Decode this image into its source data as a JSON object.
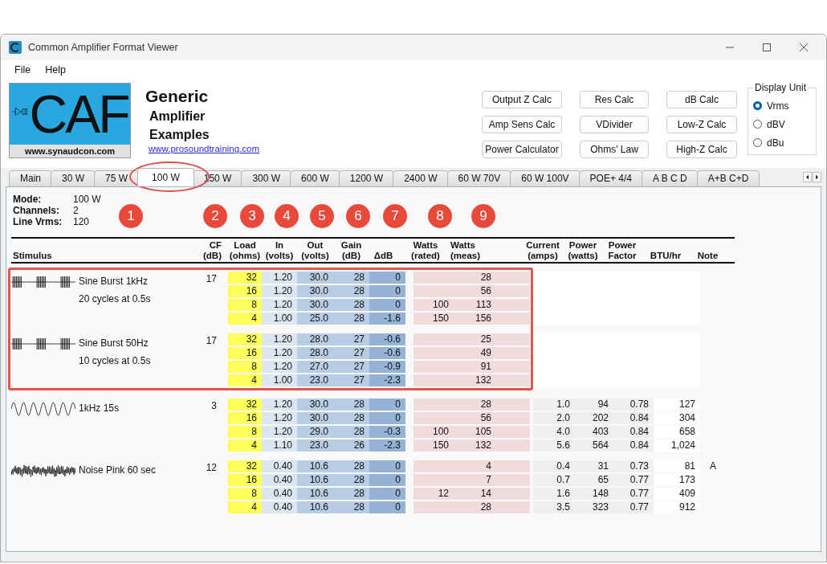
{
  "window": {
    "title": "Common Amplifier Format Viewer"
  },
  "menu": [
    "File",
    "Help"
  ],
  "logo": {
    "text": "CAF",
    "caption": "www.synaudcon.com"
  },
  "heading": {
    "title": "Generic",
    "subtitle_lines": [
      "Amplifier",
      "Examples"
    ],
    "link": "www.prosoundtraining.com"
  },
  "buttons": [
    "Output Z Calc",
    "Res Calc",
    "dB Calc",
    "Amp Sens Calc",
    "VDivider",
    "Low-Z Calc",
    "Power Calculator",
    "Ohms' Law",
    "High-Z Calc"
  ],
  "display_unit": {
    "title": "Display Unit",
    "options": [
      {
        "label": "Vrms",
        "selected": true
      },
      {
        "label": "dBV",
        "selected": false
      },
      {
        "label": "dBu",
        "selected": false
      }
    ]
  },
  "tabs": [
    {
      "label": "Main",
      "selected": false,
      "circled": false
    },
    {
      "label": "30 W",
      "selected": false,
      "circled": false
    },
    {
      "label": "75 W",
      "selected": false,
      "circled": false
    },
    {
      "label": "100 W",
      "selected": true,
      "circled": true
    },
    {
      "label": "150 W",
      "selected": false,
      "circled": false
    },
    {
      "label": "300 W",
      "selected": false,
      "circled": false
    },
    {
      "label": "600 W",
      "selected": false,
      "circled": false
    },
    {
      "label": "1200 W",
      "selected": false,
      "circled": false
    },
    {
      "label": "2400 W",
      "selected": false,
      "circled": false
    },
    {
      "label": "60 W 70V",
      "selected": false,
      "circled": false
    },
    {
      "label": "60 W 100V",
      "selected": false,
      "circled": false
    },
    {
      "label": "POE+ 4/4",
      "selected": false,
      "circled": false
    },
    {
      "label": "A B C D",
      "selected": false,
      "circled": false
    },
    {
      "label": "A+B C+D",
      "selected": false,
      "circled": false
    }
  ],
  "info": [
    {
      "label": "Mode:",
      "value": "100 W"
    },
    {
      "label": "Channels:",
      "value": "2"
    },
    {
      "label": "Line Vrms:",
      "value": "120"
    }
  ],
  "badges": [
    "1",
    "2",
    "3",
    "4",
    "5",
    "6",
    "7",
    "8",
    "9"
  ],
  "table": {
    "columns": [
      [
        "Stimulus"
      ],
      [
        "CF",
        "(dB)"
      ],
      [
        "Load",
        "(ohms)"
      ],
      [
        "In",
        "(volts)"
      ],
      [
        "Out",
        "(volts)"
      ],
      [
        "Gain",
        "(dB)"
      ],
      [
        "ΔdB"
      ],
      [
        "Watts",
        "(rated)"
      ],
      [
        "Watts",
        "(meas)"
      ],
      [
        "Current",
        "(amps)"
      ],
      [
        "Power",
        "(watts)"
      ],
      [
        "Power",
        "Factor"
      ],
      [
        "BTU/hr"
      ],
      [
        "Note"
      ]
    ],
    "sections": [
      {
        "highlighted": true,
        "groups": [
          {
            "kind": "burst",
            "name": "Sine Burst 1kHz",
            "subtitle": "20 cycles at 0.5s",
            "cf": "17",
            "rows": [
              {
                "load": "32",
                "in": "1.20",
                "out": "30.0",
                "gain": "28",
                "ddb": "0",
                "meas": "28"
              },
              {
                "load": "16",
                "in": "1.20",
                "out": "30.0",
                "gain": "28",
                "ddb": "0",
                "meas": "56"
              },
              {
                "load": "8",
                "in": "1.20",
                "out": "30.0",
                "gain": "28",
                "ddb": "0",
                "rated": "100",
                "meas": "113"
              },
              {
                "load": "4",
                "in": "1.00",
                "out": "25.0",
                "gain": "28",
                "ddb": "-1.6",
                "rated": "150",
                "meas": "156"
              }
            ]
          },
          {
            "kind": "burst",
            "name": "Sine Burst 50Hz",
            "subtitle": "10 cycles at 0.5s",
            "cf": "17",
            "rows": [
              {
                "load": "32",
                "in": "1.20",
                "out": "28.0",
                "gain": "27",
                "ddb": "-0.6",
                "meas": "25"
              },
              {
                "load": "16",
                "in": "1.20",
                "out": "28.0",
                "gain": "27",
                "ddb": "-0.6",
                "meas": "49"
              },
              {
                "load": "8",
                "in": "1.20",
                "out": "27.0",
                "gain": "27",
                "ddb": "-0.9",
                "meas": "91"
              },
              {
                "load": "4",
                "in": "1.00",
                "out": "23.0",
                "gain": "27",
                "ddb": "-2.3",
                "meas": "132"
              }
            ]
          }
        ]
      },
      {
        "highlighted": false,
        "groups": [
          {
            "kind": "sine",
            "name": "1kHz 15s",
            "cf": "3",
            "rows": [
              {
                "load": "32",
                "in": "1.20",
                "out": "30.0",
                "gain": "28",
                "ddb": "0",
                "meas": "28",
                "current": "1.0",
                "power": "94",
                "pf": "0.78",
                "btu": "127"
              },
              {
                "load": "16",
                "in": "1.20",
                "out": "30.0",
                "gain": "28",
                "ddb": "0",
                "meas": "56",
                "current": "2.0",
                "power": "202",
                "pf": "0.84",
                "btu": "304"
              },
              {
                "load": "8",
                "in": "1.20",
                "out": "29.0",
                "gain": "28",
                "ddb": "-0.3",
                "rated": "100",
                "meas": "105",
                "current": "4.0",
                "power": "403",
                "pf": "0.84",
                "btu": "658"
              },
              {
                "load": "4",
                "in": "1.10",
                "out": "23.0",
                "gain": "26",
                "ddb": "-2.3",
                "rated": "150",
                "meas": "132",
                "current": "5.6",
                "power": "564",
                "pf": "0.84",
                "btu": "1,024"
              }
            ]
          },
          {
            "kind": "noise",
            "name": "Noise Pink 60 sec",
            "cf": "12",
            "rows": [
              {
                "load": "32",
                "in": "0.40",
                "out": "10.6",
                "gain": "28",
                "ddb": "0",
                "meas": "4",
                "current": "0.4",
                "power": "31",
                "pf": "0.73",
                "btu": "81",
                "note": "A"
              },
              {
                "load": "16",
                "in": "0.40",
                "out": "10.6",
                "gain": "28",
                "ddb": "0",
                "meas": "7",
                "current": "0.7",
                "power": "65",
                "pf": "0.77",
                "btu": "173"
              },
              {
                "load": "8",
                "in": "0.40",
                "out": "10.6",
                "gain": "28",
                "ddb": "0",
                "rated": "12",
                "meas": "14",
                "current": "1.6",
                "power": "148",
                "pf": "0.77",
                "btu": "409"
              },
              {
                "load": "4",
                "in": "0.40",
                "out": "10.6",
                "gain": "28",
                "ddb": "0",
                "meas": "28",
                "current": "3.5",
                "power": "323",
                "pf": "0.77",
                "btu": "912"
              }
            ]
          }
        ]
      }
    ]
  }
}
